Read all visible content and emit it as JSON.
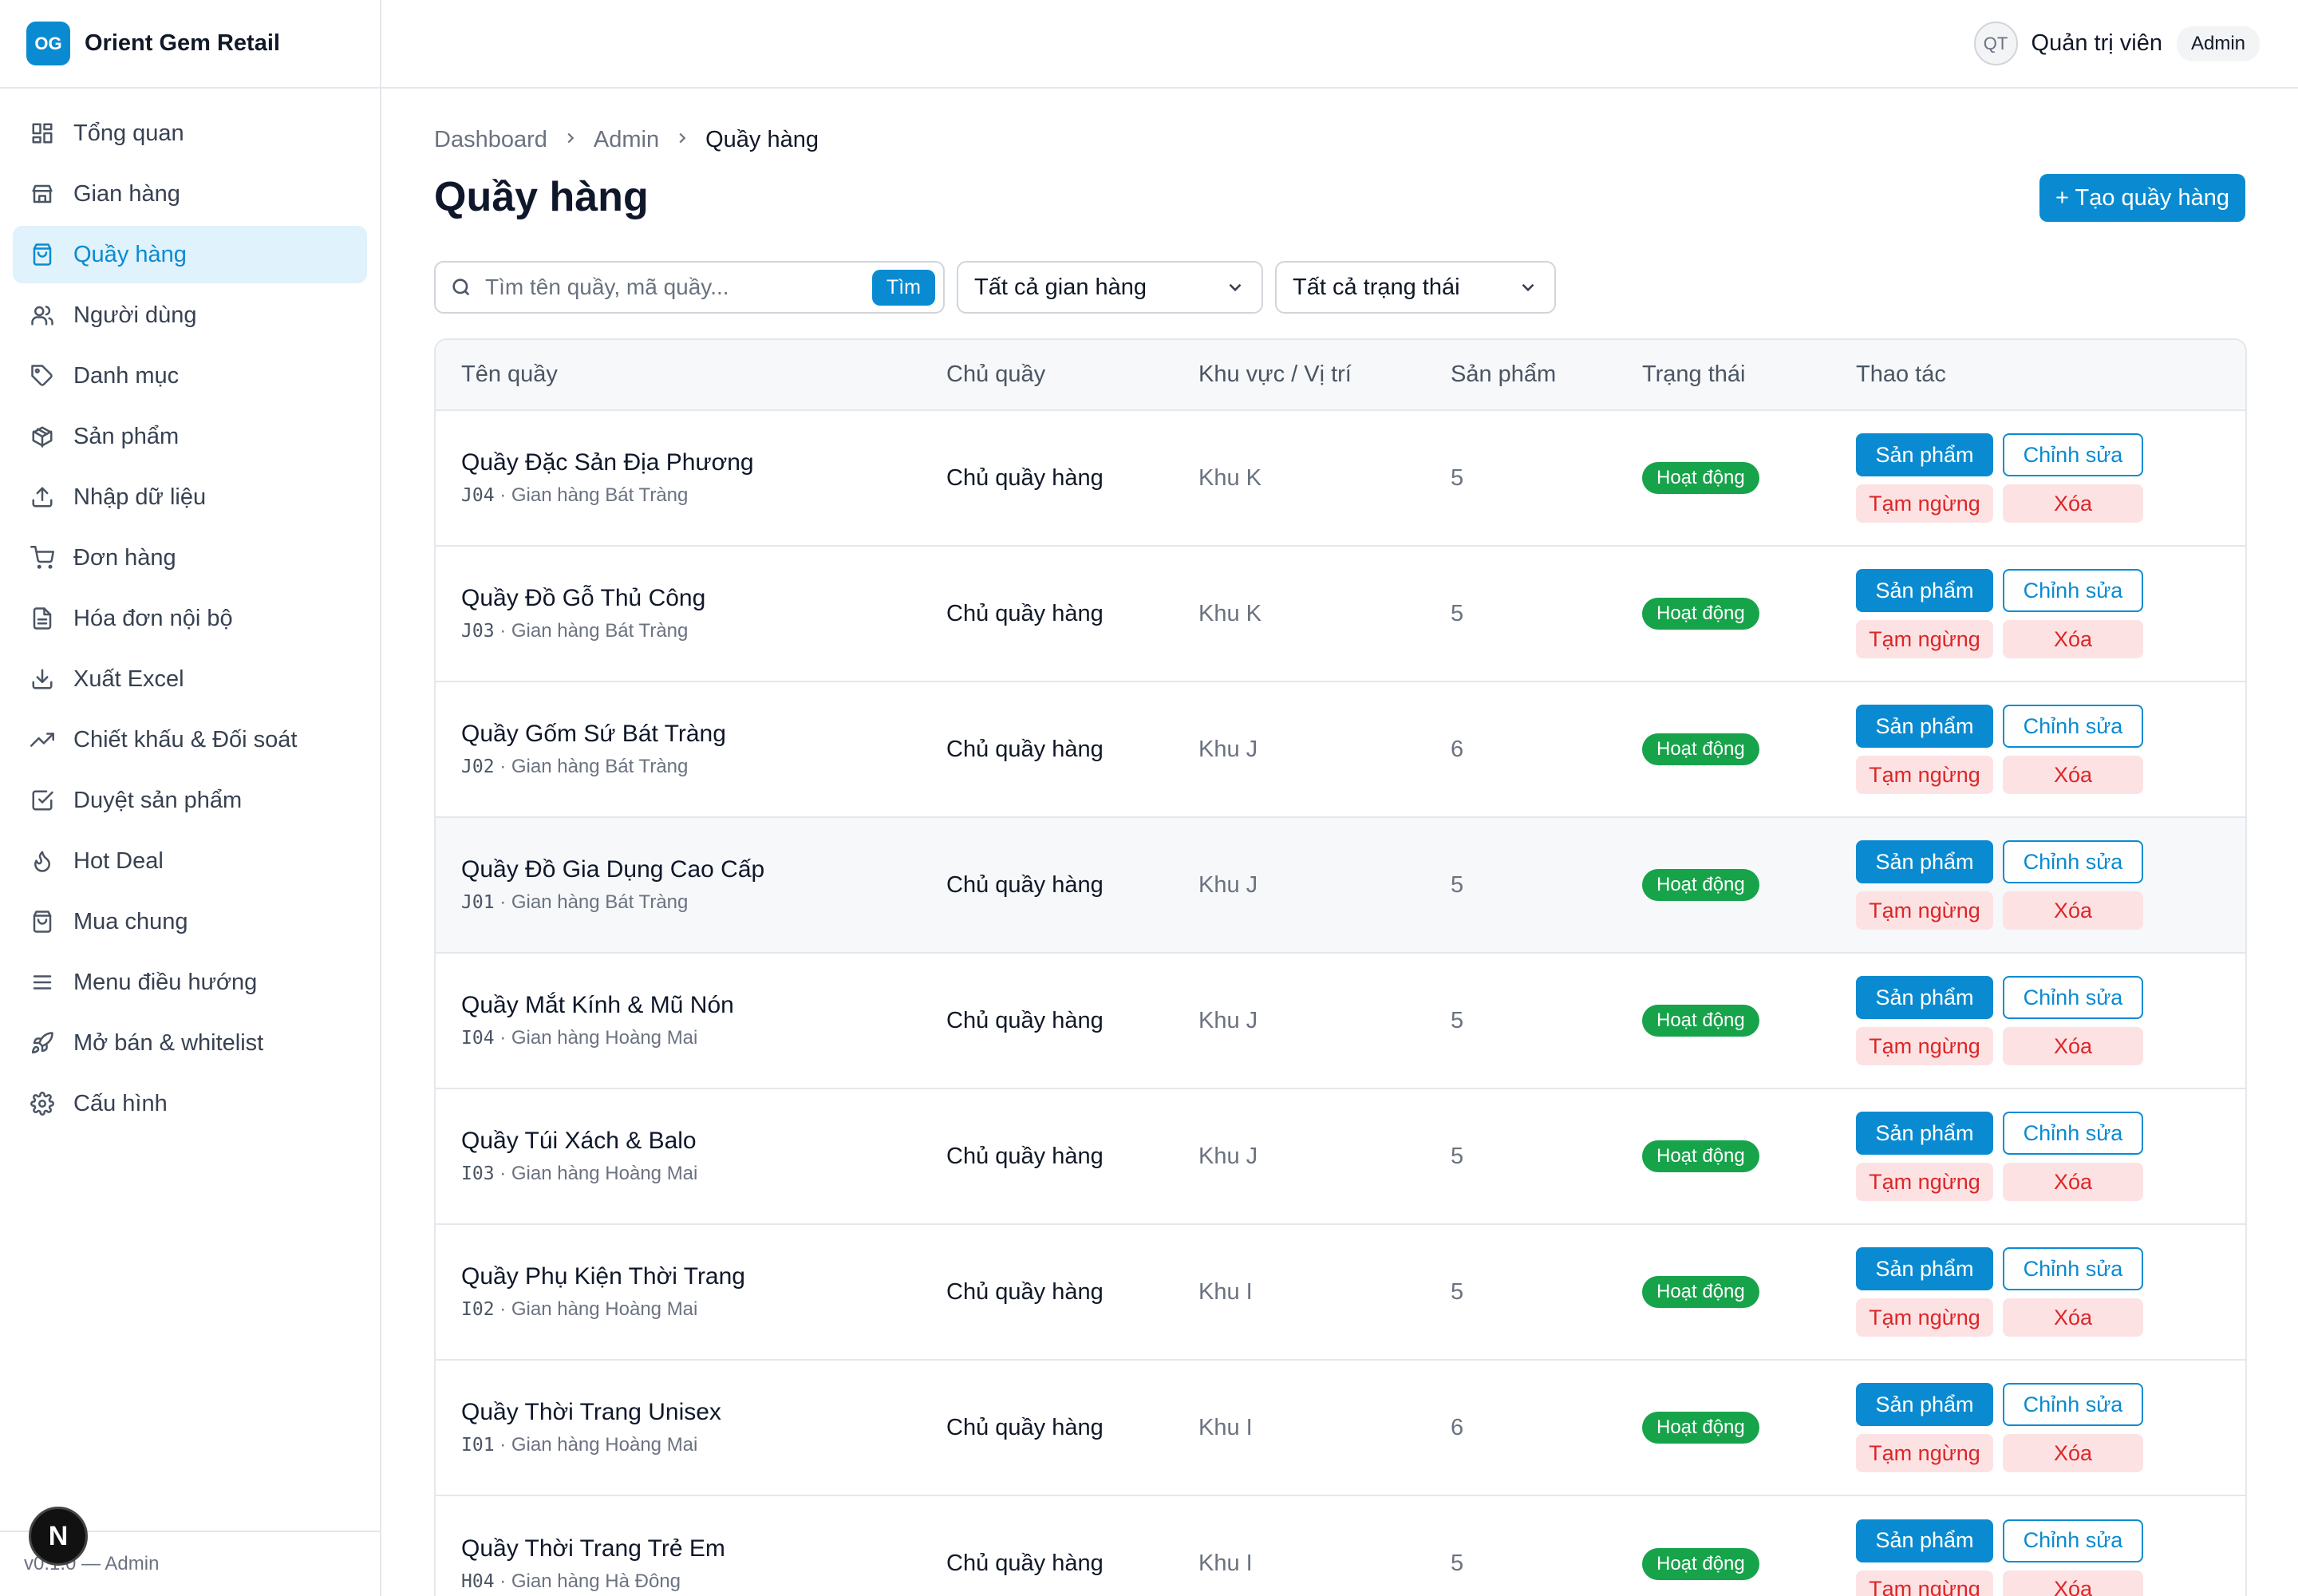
{
  "brand": {
    "logo": "OG",
    "name": "Orient Gem Retail"
  },
  "user": {
    "initials": "QT",
    "name": "Quản trị viên",
    "role": "Admin"
  },
  "sidebar": {
    "items": [
      {
        "label": "Tổng quan",
        "icon": "dashboard-icon"
      },
      {
        "label": "Gian hàng",
        "icon": "store-icon"
      },
      {
        "label": "Quầy hàng",
        "icon": "shopping-bag-icon",
        "active": true
      },
      {
        "label": "Người dùng",
        "icon": "users-icon"
      },
      {
        "label": "Danh mục",
        "icon": "tag-icon"
      },
      {
        "label": "Sản phẩm",
        "icon": "package-icon"
      },
      {
        "label": "Nhập dữ liệu",
        "icon": "upload-icon"
      },
      {
        "label": "Đơn hàng",
        "icon": "cart-icon"
      },
      {
        "label": "Hóa đơn nội bộ",
        "icon": "file-icon"
      },
      {
        "label": "Xuất Excel",
        "icon": "download-icon"
      },
      {
        "label": "Chiết khấu & Đối soát",
        "icon": "trending-icon"
      },
      {
        "label": "Duyệt sản phẩm",
        "icon": "check-square-icon"
      },
      {
        "label": "Hot Deal",
        "icon": "flame-icon"
      },
      {
        "label": "Mua chung",
        "icon": "bag-icon"
      },
      {
        "label": "Menu điều hướng",
        "icon": "menu-icon"
      },
      {
        "label": "Mở bán & whitelist",
        "icon": "rocket-icon"
      },
      {
        "label": "Cấu hình",
        "icon": "gear-icon"
      }
    ],
    "footer": "v0.1.0 — Admin",
    "dev_badge": "N"
  },
  "breadcrumb": [
    "Dashboard",
    "Admin",
    "Quầy hàng"
  ],
  "page": {
    "title": "Quầy hàng",
    "create_label": "+ Tạo quầy hàng"
  },
  "filters": {
    "search_placeholder": "Tìm tên quầy, mã quầy...",
    "search_button": "Tìm",
    "store_select": "Tất cả gian hàng",
    "status_select": "Tất cả trạng thái"
  },
  "table": {
    "columns": [
      "Tên quầy",
      "Chủ quầy",
      "Khu vực / Vị trí",
      "Sản phẩm",
      "Trạng thái",
      "Thao tác"
    ],
    "action_labels": {
      "products": "Sản phẩm",
      "edit": "Chỉnh sửa",
      "pause": "Tạm ngừng",
      "delete": "Xóa"
    },
    "rows": [
      {
        "name": "Quầy Đặc Sản Địa Phương",
        "code": "J04",
        "store": " · Gian hàng Bát Tràng",
        "owner": "Chủ quầy hàng",
        "zone": "Khu K",
        "products": "5",
        "status": "Hoạt động"
      },
      {
        "name": "Quầy Đồ Gỗ Thủ Công",
        "code": "J03",
        "store": " · Gian hàng Bát Tràng",
        "owner": "Chủ quầy hàng",
        "zone": "Khu K",
        "products": "5",
        "status": "Hoạt động"
      },
      {
        "name": "Quầy Gốm Sứ Bát Tràng",
        "code": "J02",
        "store": " · Gian hàng Bát Tràng",
        "owner": "Chủ quầy hàng",
        "zone": "Khu J",
        "products": "6",
        "status": "Hoạt động"
      },
      {
        "name": "Quầy Đồ Gia Dụng Cao Cấp",
        "code": "J01",
        "store": " · Gian hàng Bát Tràng",
        "owner": "Chủ quầy hàng",
        "zone": "Khu J",
        "products": "5",
        "status": "Hoạt động"
      },
      {
        "name": "Quầy Mắt Kính & Mũ Nón",
        "code": "I04",
        "store": " · Gian hàng Hoàng Mai",
        "owner": "Chủ quầy hàng",
        "zone": "Khu J",
        "products": "5",
        "status": "Hoạt động"
      },
      {
        "name": "Quầy Túi Xách & Balo",
        "code": "I03",
        "store": " · Gian hàng Hoàng Mai",
        "owner": "Chủ quầy hàng",
        "zone": "Khu J",
        "products": "5",
        "status": "Hoạt động"
      },
      {
        "name": "Quầy Phụ Kiện Thời Trang",
        "code": "I02",
        "store": " · Gian hàng Hoàng Mai",
        "owner": "Chủ quầy hàng",
        "zone": "Khu I",
        "products": "5",
        "status": "Hoạt động"
      },
      {
        "name": "Quầy Thời Trang Unisex",
        "code": "I01",
        "store": " · Gian hàng Hoàng Mai",
        "owner": "Chủ quầy hàng",
        "zone": "Khu I",
        "products": "6",
        "status": "Hoạt động"
      },
      {
        "name": "Quầy Thời Trang Trẻ Em",
        "code": "H04",
        "store": " · Gian hàng Hà Đông",
        "owner": "Chủ quầy hàng",
        "zone": "Khu I",
        "products": "5",
        "status": "Hoạt động"
      }
    ]
  },
  "colors": {
    "accent": "#0a8bd1",
    "status_active": "#16a34a",
    "danger": "#dc2626",
    "danger_bg": "#fde2e4"
  }
}
